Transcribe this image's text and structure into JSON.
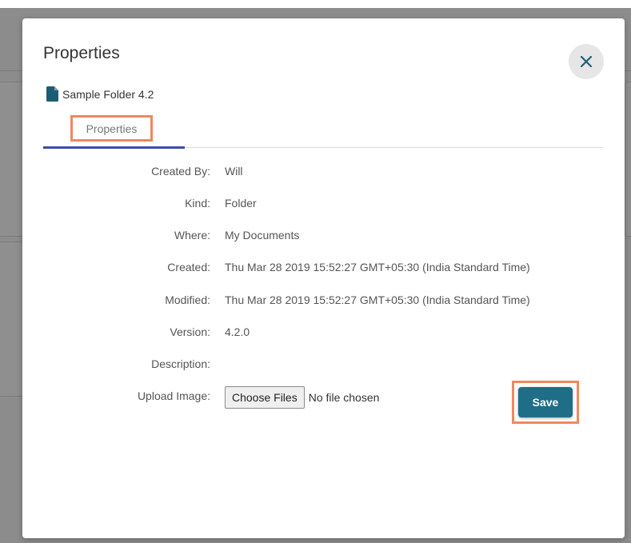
{
  "dialog": {
    "title": "Properties",
    "close_icon": "close-icon",
    "file_icon": "file-icon",
    "file_name": "Sample Folder 4.2",
    "tab_label": "Properties",
    "highlight_color": "#f0885e",
    "accent_color": "#1e6e87"
  },
  "properties": [
    {
      "label": "Created By:",
      "value": "Will"
    },
    {
      "label": "Kind:",
      "value": "Folder"
    },
    {
      "label": "Where:",
      "value": "My Documents"
    },
    {
      "label": "Created:",
      "value": "Thu Mar 28 2019 15:52:27 GMT+05:30 (India Standard Time)"
    },
    {
      "label": "Modified:",
      "value": "Thu Mar 28 2019 15:52:27 GMT+05:30 (India Standard Time)"
    },
    {
      "label": "Version:",
      "value": "4.2.0"
    },
    {
      "label": "Description:",
      "value": ""
    }
  ],
  "upload": {
    "label": "Upload Image:",
    "button_label": "Choose Files",
    "status": "No file chosen"
  },
  "save_label": "Save"
}
